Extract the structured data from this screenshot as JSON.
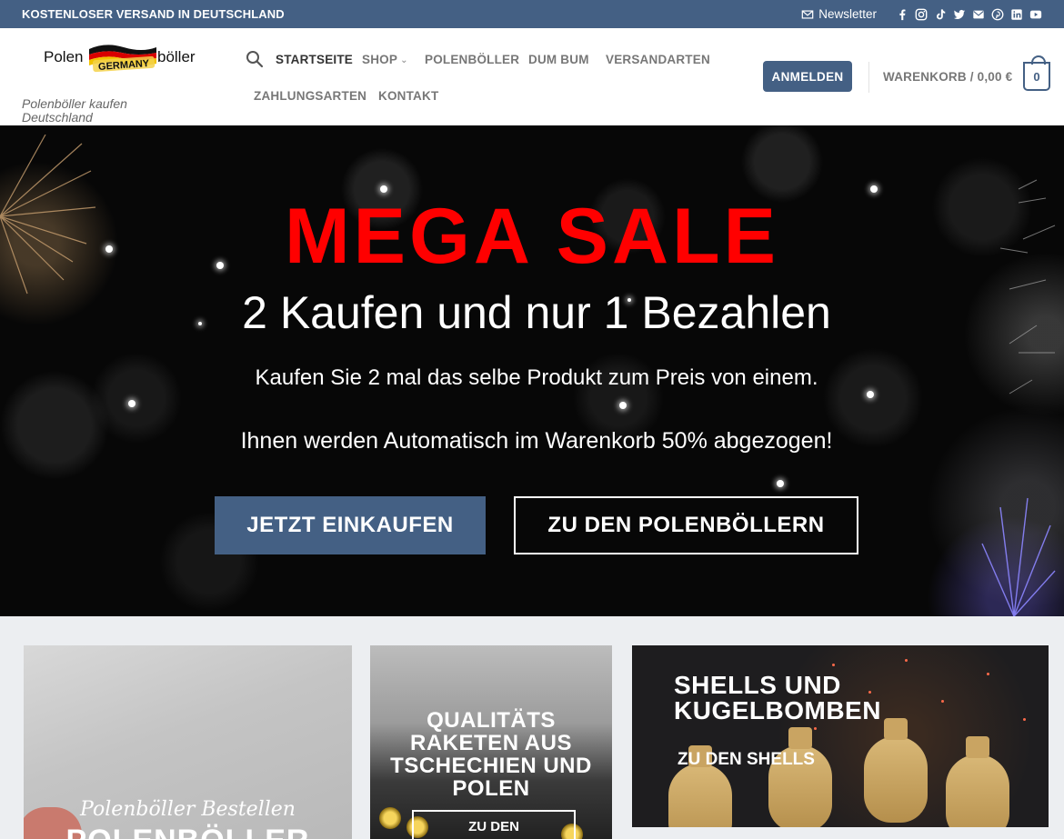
{
  "topbar": {
    "promo": "KOSTENLOSER VERSAND IN DEUTSCHLAND",
    "newsletter": "Newsletter",
    "social_icons": [
      "facebook-icon",
      "instagram-icon",
      "tiktok-icon",
      "twitter-icon",
      "email-icon",
      "pinterest-icon",
      "linkedin-icon",
      "youtube-icon"
    ]
  },
  "header": {
    "logo": {
      "left": "Polen",
      "flag": "GERMANY",
      "right": "böller"
    },
    "tagline": "Polenböller kaufen Deutschland",
    "nav": [
      "STARTSEITE",
      "SHOP",
      "POLENBÖLLER",
      "DUM BUM",
      "VERSANDARTEN",
      "ZAHLUNGSARTEN",
      "KONTAKT"
    ],
    "login": "ANMELDEN",
    "cart_label": "WARENKORB / 0,00 €",
    "cart_count": "0"
  },
  "hero": {
    "title": "MEGA SALE",
    "subtitle": "2 Kaufen und nur 1 Bezahlen",
    "line1": "Kaufen Sie 2 mal das selbe Produkt zum Preis von einem.",
    "line2": "Ihnen werden Automatisch im Warenkorb 50% abgezogen!",
    "btn_primary": "JETZT EINKAUFEN",
    "btn_outline": "ZU DEN POLENBÖLLERN"
  },
  "tiles": {
    "polenboller": {
      "script": "Polenböller Bestellen",
      "title": "POLENBÖLLER"
    },
    "raketen": {
      "title": "QUALITÄTS RAKETEN AUS TSCHECHIEN UND POLEN",
      "button": "ZU DEN"
    },
    "shells": {
      "title": "SHELLS UND KUGELBOMBEN",
      "link": "ZU DEN SHELLS"
    }
  },
  "colors": {
    "primary": "#446084",
    "sale_red": "#ff0000"
  }
}
